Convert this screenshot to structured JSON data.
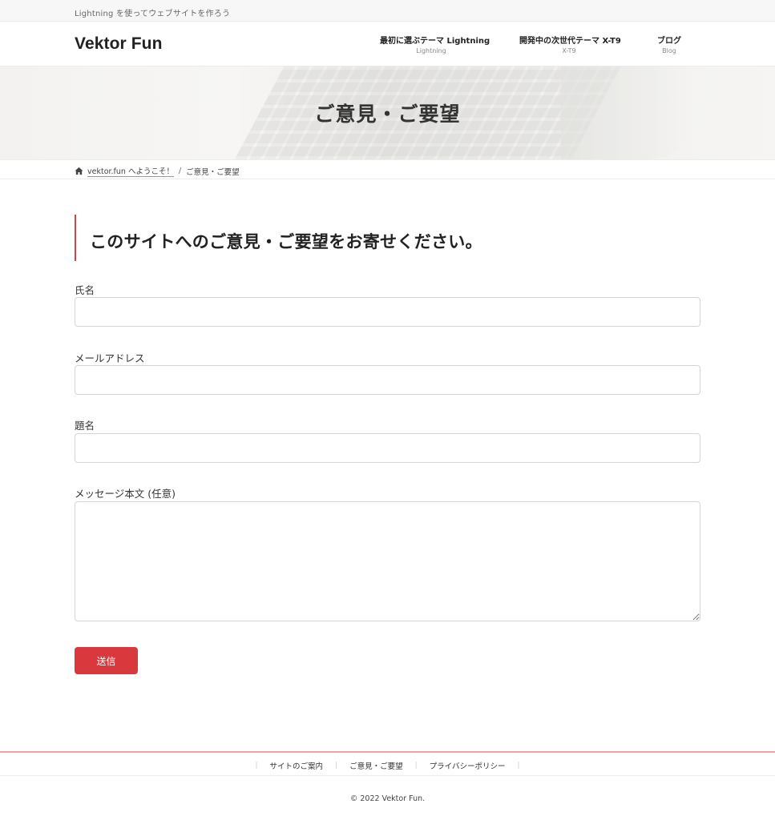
{
  "topbar": {
    "tagline": "Lightning を使ってウェブサイトを作ろう"
  },
  "header": {
    "site_title": "Vektor Fun",
    "nav": [
      {
        "label": "最初に選ぶテーマ Lightning",
        "sub": "Lightning"
      },
      {
        "label": "開発中の次世代テーマ X-T9",
        "sub": "X-T9"
      },
      {
        "label": "ブログ",
        "sub": "Blog"
      }
    ]
  },
  "hero": {
    "title": "ご意見・ご要望"
  },
  "breadcrumb": {
    "home_icon": "home-icon",
    "home_label": "vektor.fun へようこそ！",
    "separator": "/",
    "current": "ご意見・ご要望"
  },
  "main": {
    "heading": "このサイトへのご意見・ご要望をお寄せください。",
    "form": {
      "name_label": "氏名",
      "name_value": "",
      "email_label": "メールアドレス",
      "email_value": "",
      "subject_label": "題名",
      "subject_value": "",
      "message_label": "メッセージ本文 (任意)",
      "message_value": "",
      "submit_label": "送信"
    }
  },
  "footer": {
    "links": [
      "サイトのご案内",
      "ご意見・ご要望",
      "プライバシーポリシー"
    ],
    "copyright": "© 2022 Vektor Fun."
  },
  "colors": {
    "accent": "#d9393c",
    "heading_border": "#c9484b",
    "footer_border": "#e6a6a8"
  }
}
